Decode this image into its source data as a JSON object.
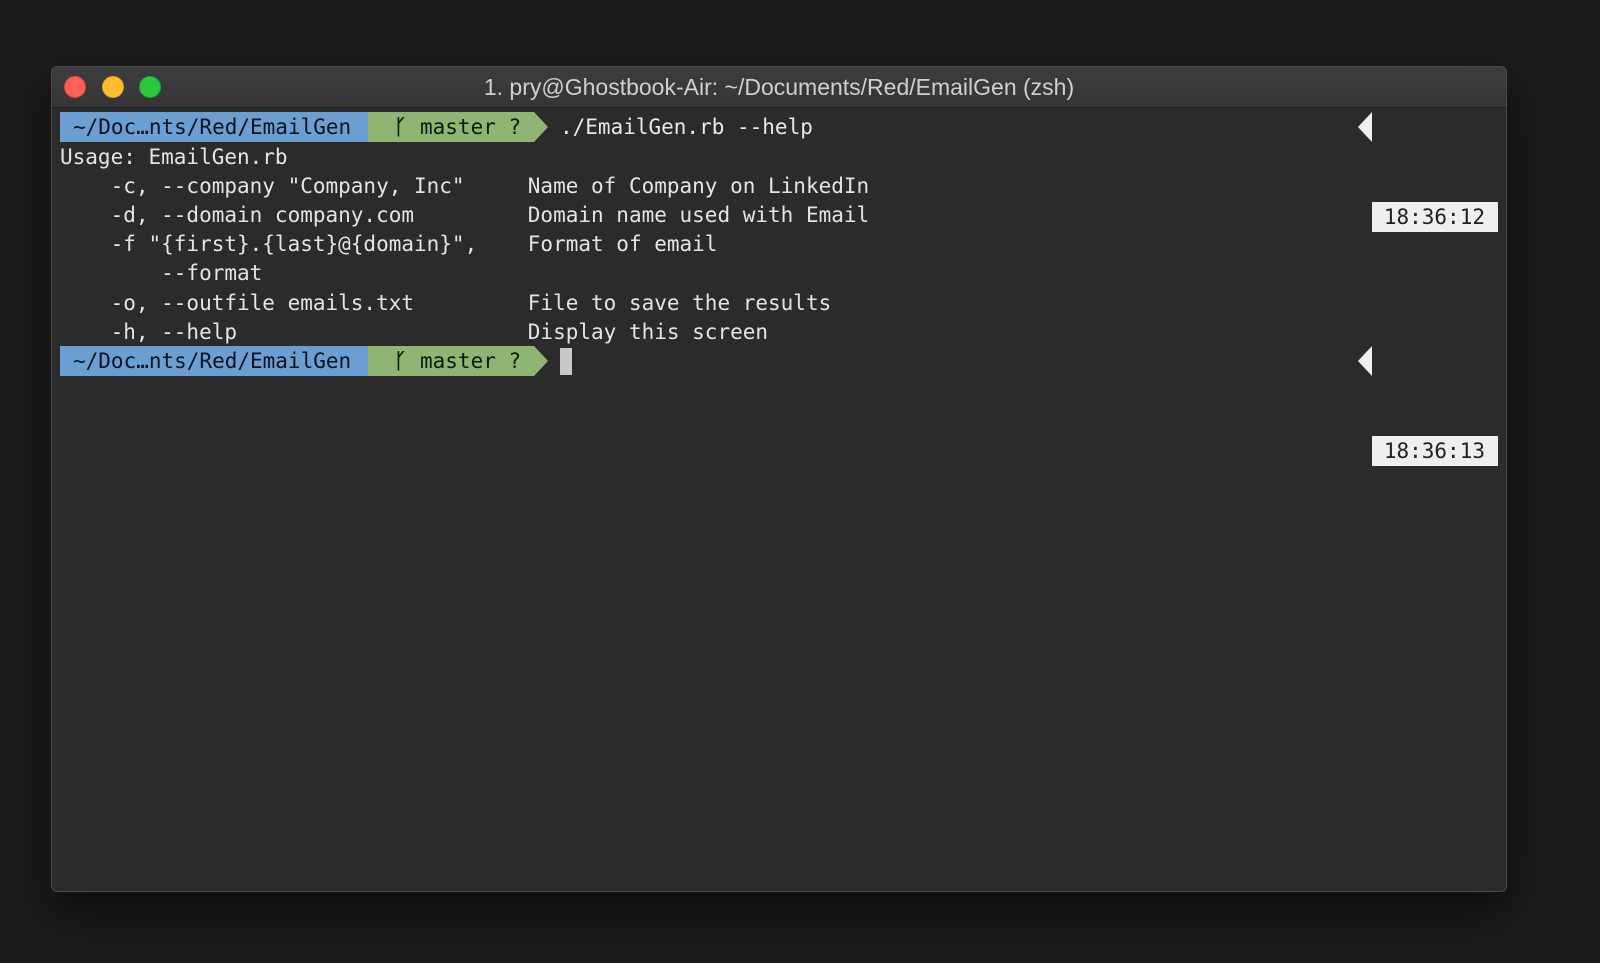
{
  "window": {
    "title": "1. pry@Ghostbook-Air: ~/Documents/Red/EmailGen (zsh)"
  },
  "colors": {
    "path_segment": "#6b9fd1",
    "git_segment": "#8fb573",
    "time_segment": "#efefef",
    "background": "#2b2b2b"
  },
  "prompt1": {
    "path": "~/Doc…nts/Red/EmailGen",
    "branch_icon": "git-branch-icon",
    "branch": "master ?",
    "command": "./EmailGen.rb --help",
    "time": "18:36:12"
  },
  "output": [
    "Usage: EmailGen.rb",
    "    -c, --company \"Company, Inc\"     Name of Company on LinkedIn",
    "    -d, --domain company.com         Domain name used with Email",
    "    -f \"{first}.{last}@{domain}\",    Format of email",
    "        --format",
    "    -o, --outfile emails.txt         File to save the results",
    "    -h, --help                       Display this screen"
  ],
  "prompt2": {
    "path": "~/Doc…nts/Red/EmailGen",
    "branch_icon": "git-branch-icon",
    "branch": "master ?",
    "command": "",
    "time": "18:36:13"
  }
}
